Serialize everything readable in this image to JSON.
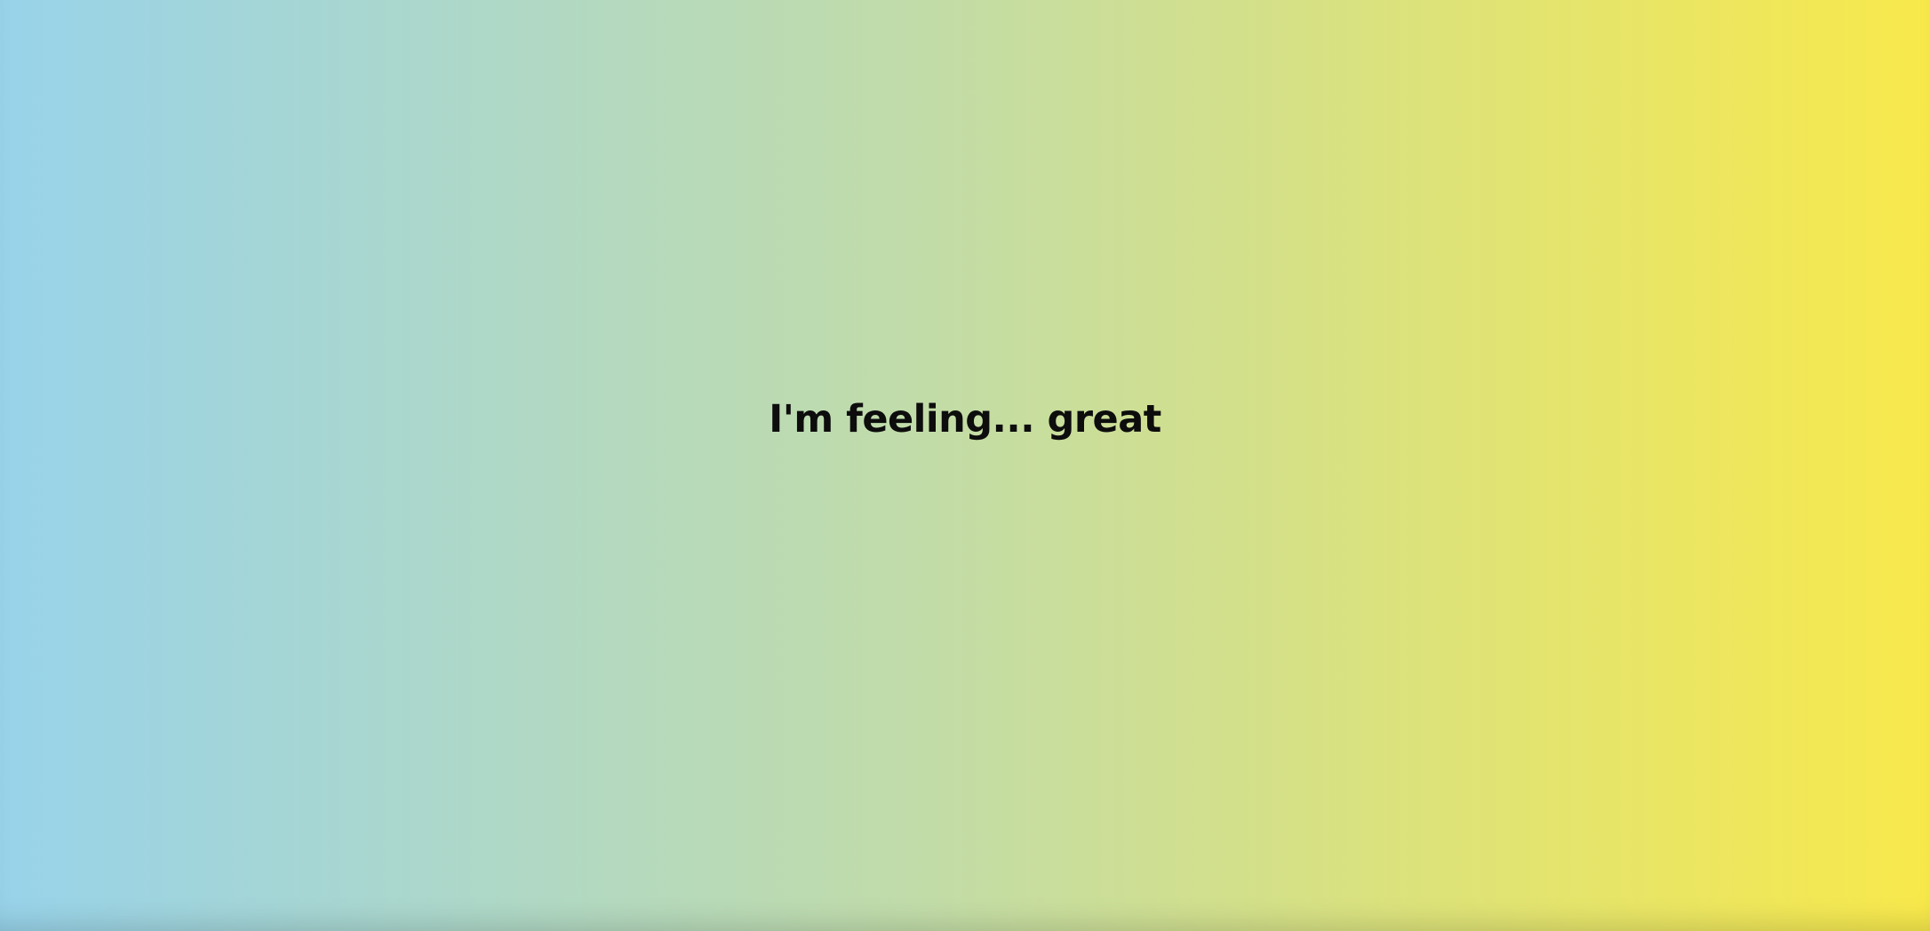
{
  "page": {
    "mood_prefix": "I'm feeling...",
    "mood_value": "great"
  },
  "colors": {
    "gradient_start": "#98d3ea",
    "gradient_mid": "#c2dca8",
    "gradient_end": "#f8e94b",
    "text": "#0d0d0d"
  }
}
